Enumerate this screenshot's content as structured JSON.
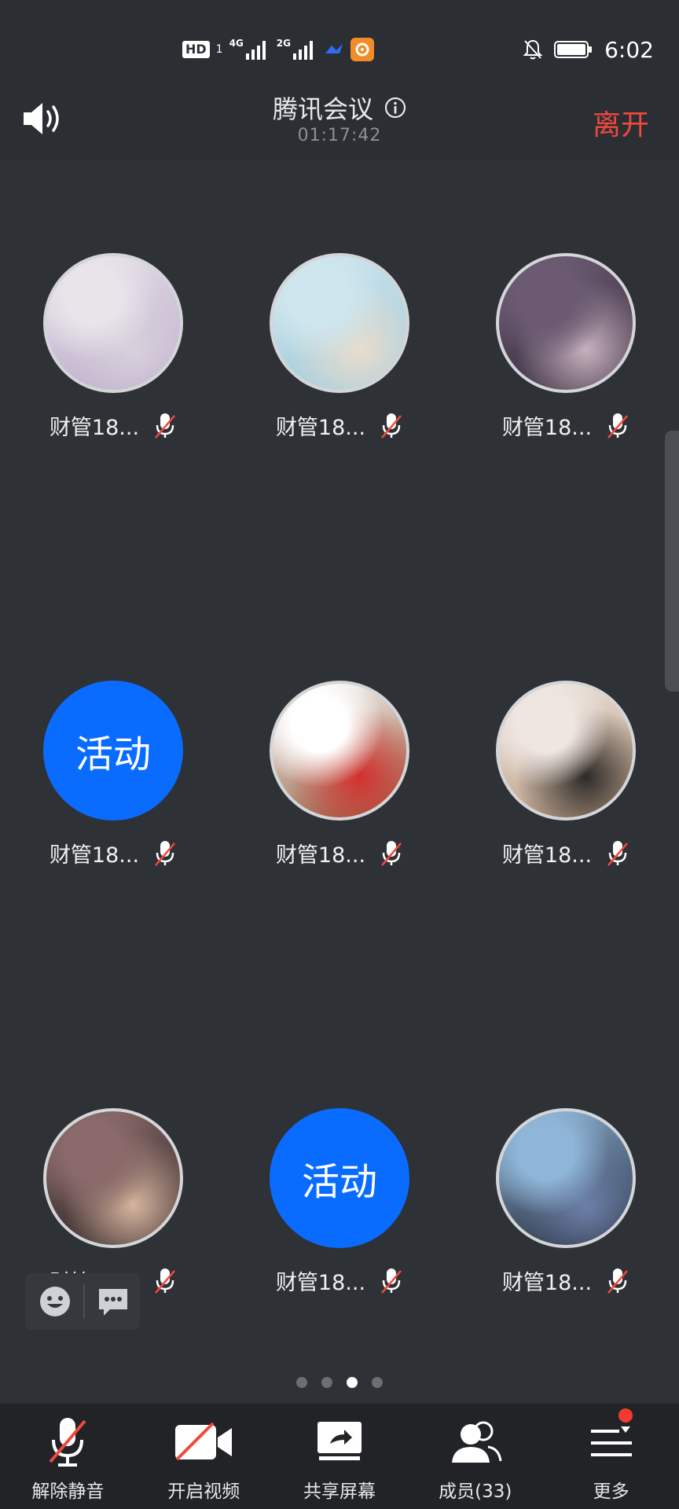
{
  "status_bar": {
    "hd_label": "HD",
    "sim_number": "1",
    "network_1": "4G",
    "network_2": "2G",
    "time": "6:02",
    "icons": [
      "hd-icon",
      "signal-4g-icon",
      "signal-2g-icon",
      "feishu-icon",
      "uc-browser-icon",
      "bell-off-icon",
      "battery-icon"
    ]
  },
  "header": {
    "title": "腾讯会议",
    "timer": "01:17:42",
    "leave_label": "离开"
  },
  "participants": [
    {
      "name": "财管18...",
      "type": "photo",
      "palette": [
        "#e8e4ea",
        "#b7a6c8",
        "#d8d0db"
      ]
    },
    {
      "name": "财管18...",
      "type": "photo",
      "palette": [
        "#cfe6ee",
        "#9fc9d9",
        "#e9dccd"
      ]
    },
    {
      "name": "财管18...",
      "type": "photo",
      "palette": [
        "#6b5a72",
        "#3a2f40",
        "#c6b0bd"
      ]
    },
    {
      "name": "财管18...",
      "type": "text",
      "text": "活动"
    },
    {
      "name": "财管18...",
      "type": "photo",
      "palette": [
        "#ffffff",
        "#8d5b3b",
        "#d3312e"
      ]
    },
    {
      "name": "财管18...",
      "type": "photo",
      "palette": [
        "#efe6e2",
        "#b79a7c",
        "#2f2a28"
      ]
    },
    {
      "name": "财管18...",
      "type": "photo",
      "palette": [
        "#8a6a6a",
        "#2a2222",
        "#d7b59f"
      ]
    },
    {
      "name": "财管18...",
      "type": "text",
      "text": "活动"
    },
    {
      "name": "财管18...",
      "type": "photo",
      "palette": [
        "#8fb6d8",
        "#1e2230",
        "#6c7fa8"
      ]
    }
  ],
  "pager": {
    "count": 4,
    "active_index": 2
  },
  "toolbar": {
    "unmute_label": "解除静音",
    "video_label": "开启视频",
    "share_label": "共享屏幕",
    "members_label": "成员(33)",
    "more_label": "更多"
  },
  "colors": {
    "background": "#2e3136",
    "accent_blue": "#0a6cff",
    "leave_red": "#f0493d",
    "toolbar_bg": "#212326"
  }
}
